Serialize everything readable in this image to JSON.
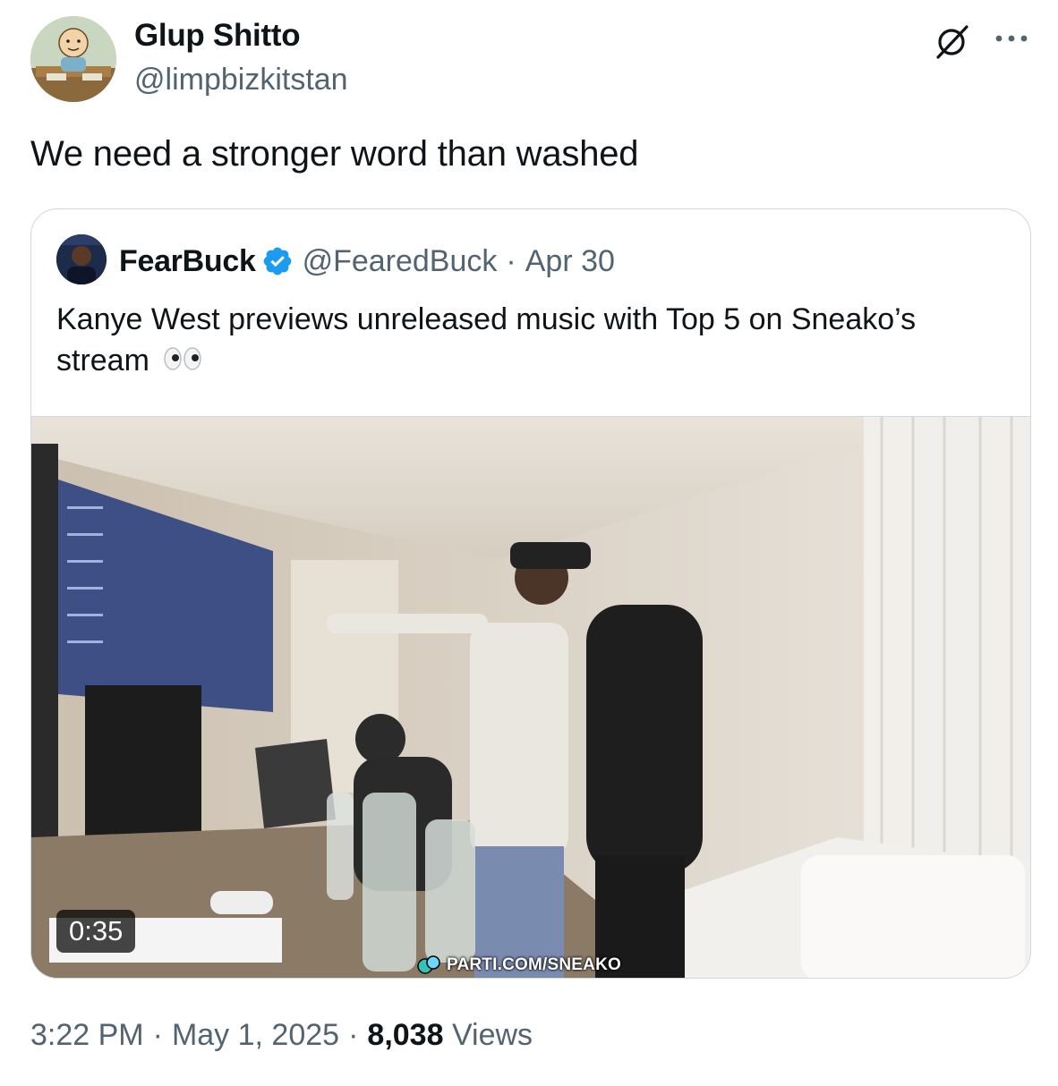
{
  "author": {
    "name": "Glup Shitto",
    "handle": "@limpbizkitstan",
    "avatar_icon": "cartoon-avatar-icon"
  },
  "header_icons": {
    "grok": "grok-icon",
    "more": "more-icon"
  },
  "tweet": {
    "text": "We need a stronger word than washed"
  },
  "quote": {
    "name": "FearBuck",
    "verified": true,
    "handle": "@FearedBuck",
    "separator": "·",
    "date": "Apr 30",
    "text": "Kanye West previews unreleased music with Top 5 on Sneako’s stream",
    "emoji": "eyes-emoji",
    "video": {
      "duration": "0:35",
      "watermark": "PARTI.COM/SNEAKO"
    }
  },
  "meta": {
    "time": "3:22 PM",
    "date": "May 1, 2025",
    "separator": "·",
    "views_count": "8,038",
    "views_label": "Views"
  },
  "colors": {
    "text_primary": "#0f1419",
    "text_secondary": "#536471",
    "border": "#cfd9de",
    "verified_blue": "#1d9bf0"
  }
}
